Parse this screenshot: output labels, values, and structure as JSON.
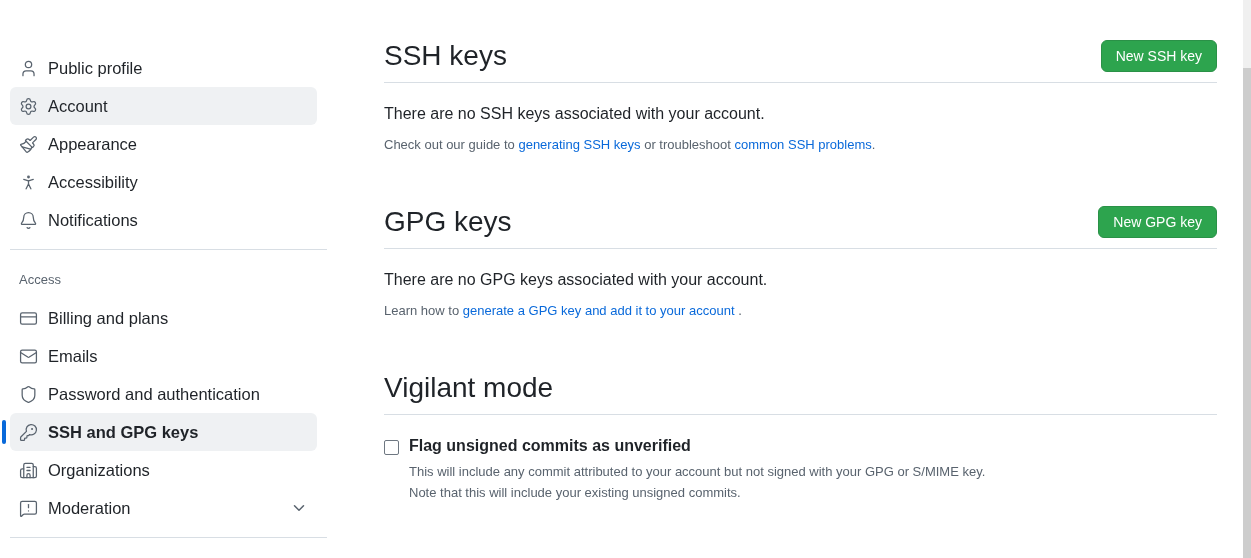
{
  "sidebar": {
    "groups": [
      {
        "items": [
          {
            "label": "Public profile",
            "selected": false
          },
          {
            "label": "Account",
            "selected": false,
            "highlighted": true
          },
          {
            "label": "Appearance",
            "selected": false
          },
          {
            "label": "Accessibility",
            "selected": false
          },
          {
            "label": "Notifications",
            "selected": false
          }
        ]
      },
      {
        "heading": "Access",
        "items": [
          {
            "label": "Billing and plans",
            "selected": false
          },
          {
            "label": "Emails",
            "selected": false
          },
          {
            "label": "Password and authentication",
            "selected": false
          },
          {
            "label": "SSH and GPG keys",
            "selected": true
          },
          {
            "label": "Organizations",
            "selected": false
          },
          {
            "label": "Moderation",
            "selected": false,
            "expanded": false
          }
        ]
      }
    ]
  },
  "sections": [
    {
      "title": "SSH keys",
      "button": "New SSH key",
      "empty": "There are no SSH keys associated with your account.",
      "help": [
        {
          "kind": "text",
          "text": "Check out our guide to "
        },
        {
          "kind": "link",
          "text": "generating SSH keys"
        },
        {
          "kind": "text",
          "text": " or troubleshoot "
        },
        {
          "kind": "link",
          "text": "common SSH problems"
        },
        {
          "kind": "text",
          "text": "."
        }
      ]
    },
    {
      "title": "GPG keys",
      "button": "New GPG key",
      "empty": "There are no GPG keys associated with your account.",
      "help": [
        {
          "kind": "text",
          "text": "Learn how to "
        },
        {
          "kind": "link",
          "text": "generate a GPG key and add it to your account"
        },
        {
          "kind": "text",
          "text": " ."
        }
      ]
    }
  ],
  "vigilant": {
    "title": "Vigilant mode",
    "option": {
      "label": "Flag unsigned commits as unverified",
      "checked": false,
      "notes": [
        "This will include any commit attributed to your account but not signed with your GPG or S/MIME key.",
        "Note that this will include your existing unsigned commits."
      ]
    }
  }
}
